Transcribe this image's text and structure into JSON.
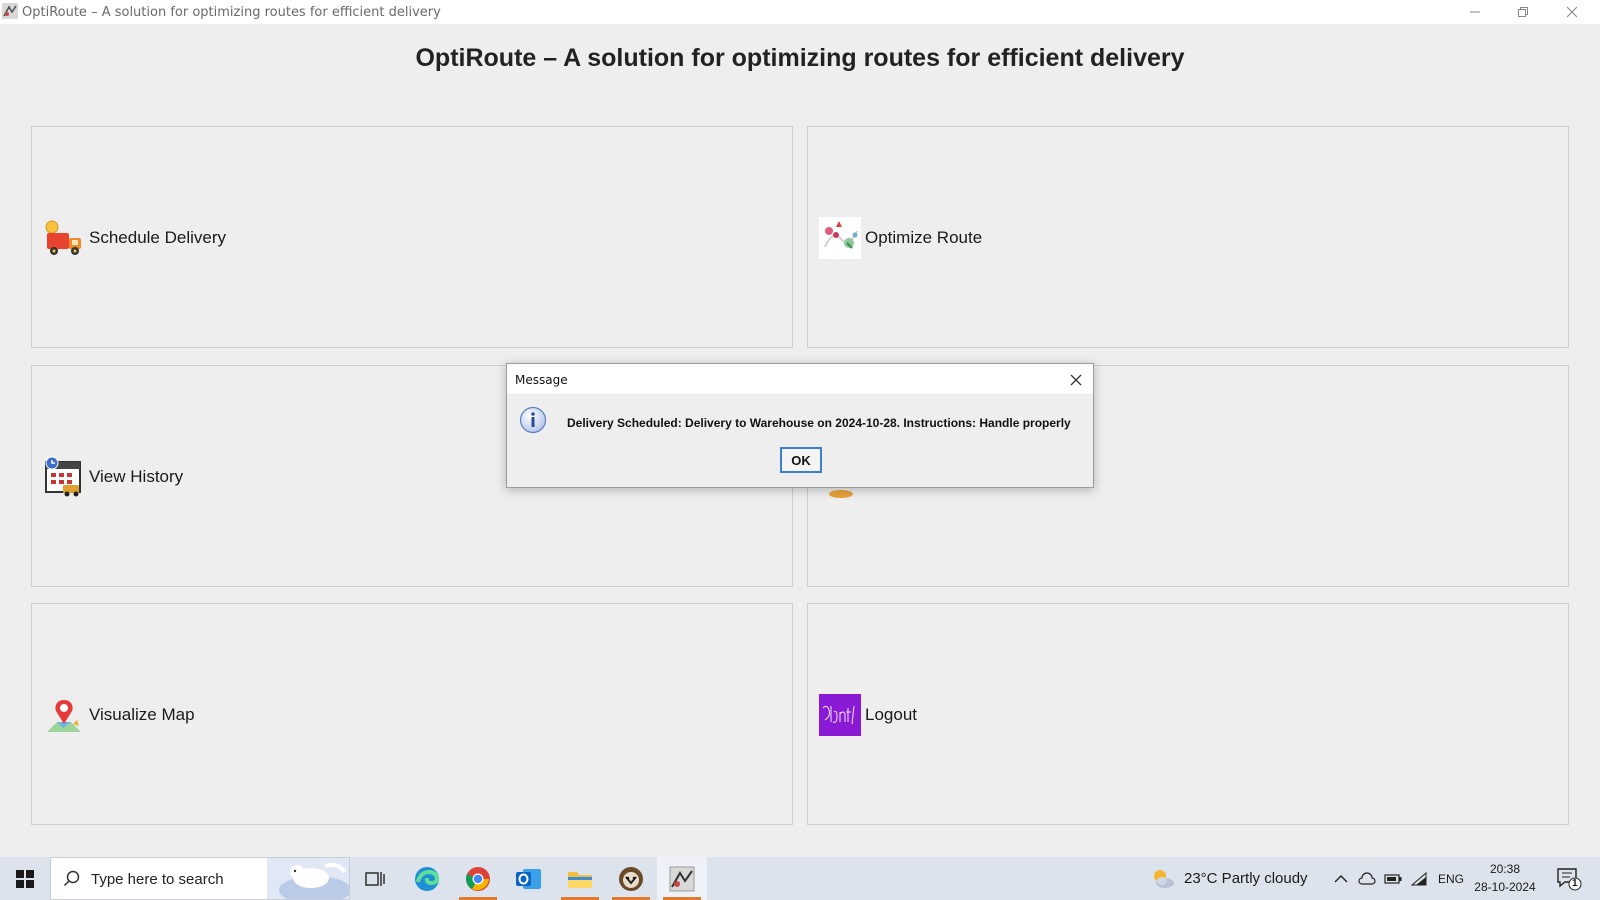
{
  "window": {
    "title": "OptiRoute – A solution for optimizing routes for efficient delivery",
    "heading": "OptiRoute – A solution for optimizing routes for efficient delivery"
  },
  "panels": [
    {
      "label": "Schedule Delivery",
      "icon": "delivery-truck-icon"
    },
    {
      "label": "Optimize Route",
      "icon": "route-map-icon"
    },
    {
      "label": "View History",
      "icon": "history-calendar-icon"
    },
    {
      "label": "",
      "icon": "hidden-feature-icon"
    },
    {
      "label": "Visualize Map",
      "icon": "map-pin-icon"
    },
    {
      "label": "Logout",
      "icon": "signout-icon"
    }
  ],
  "dialog": {
    "title": "Message",
    "message": "Delivery Scheduled: Delivery to Warehouse on 2024-10-28. Instructions: Handle properly",
    "ok_label": "OK"
  },
  "taskbar": {
    "search_placeholder": "Type here to search",
    "weather": "23°C  Partly cloudy",
    "language": "ENG",
    "time": "20:38",
    "date": "28-10-2024",
    "notification_count": "1"
  },
  "colors": {
    "accent": "#3c7fd8",
    "taskbar_active": "#e07a2f",
    "logout_icon": "#8a1ad6"
  }
}
